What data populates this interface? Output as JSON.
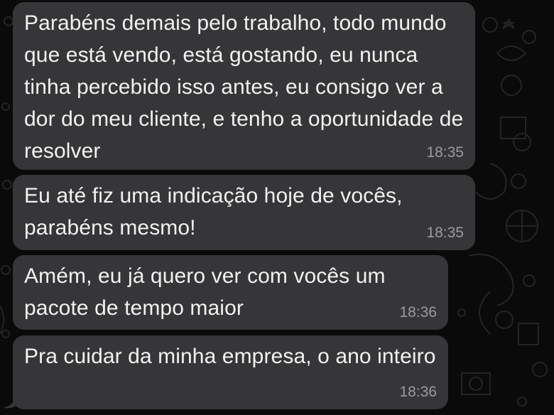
{
  "messages": [
    {
      "text": "Parabéns demais pelo trabalho, todo mundo que está vendo, está gostando, eu nunca tinha percebido isso antes, eu consigo ver a dor do meu cliente, e tenho a oportunidade de resolver",
      "time": "18:35"
    },
    {
      "text": "Eu até fiz uma indicação hoje de vocês, parabéns mesmo!",
      "time": "18:35"
    },
    {
      "text": "Amém, eu já quero ver com vocês um pacote de tempo maior",
      "time": "18:36"
    },
    {
      "text": "Pra cuidar da minha empresa, o ano inteiro",
      "time": "18:36"
    }
  ],
  "colors": {
    "background": "#0a0a0a",
    "bubble": "#363638",
    "text": "#f2f2f2",
    "timestamp": "#9b9b9e"
  }
}
